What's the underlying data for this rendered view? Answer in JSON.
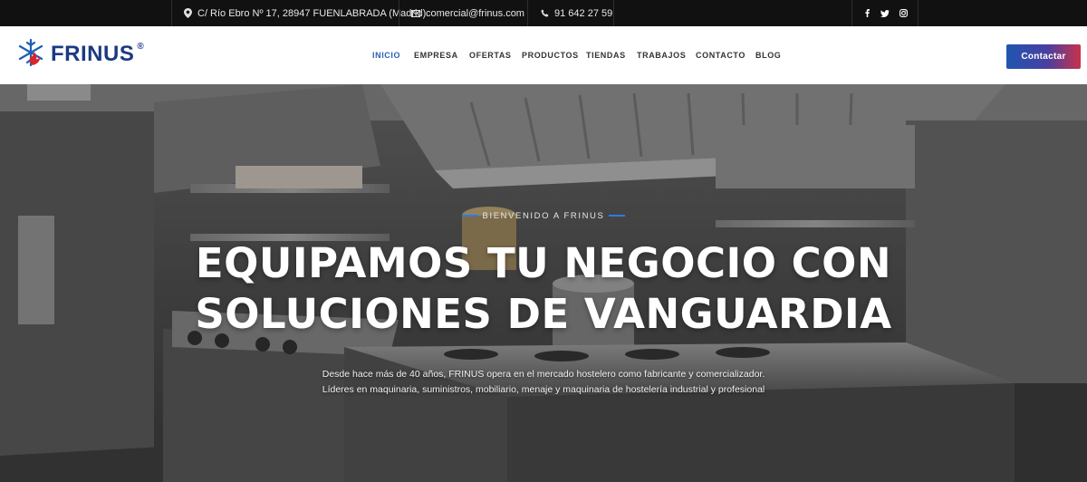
{
  "topbar": {
    "address": "C/ Río Ebro Nº 17, 28947 FUENLABRADA (Madrid)",
    "email": "comercial@frinus.com",
    "phone": "91 642 27 59",
    "icons": {
      "address": "map-marker-icon",
      "email": "envelope-icon",
      "phone": "phone-icon"
    },
    "social": [
      "facebook-icon",
      "twitter-icon",
      "instagram-icon"
    ]
  },
  "header": {
    "logo_text": "FRINUS",
    "logo_reg": "®",
    "nav": [
      {
        "label": "INICIO",
        "active": true
      },
      {
        "label": "EMPRESA",
        "active": false
      },
      {
        "label": "OFERTAS",
        "active": false
      },
      {
        "label": "PRODUCTOS",
        "active": false
      },
      {
        "label": "TIENDAS",
        "active": false
      },
      {
        "label": "TRABAJOS",
        "active": false
      },
      {
        "label": "CONTACTO",
        "active": false
      },
      {
        "label": "BLOG",
        "active": false
      }
    ],
    "cta_label": "Contactar"
  },
  "hero": {
    "eyebrow": "BIENVENIDO A FRINUS",
    "headline_line1": "EQUIPAMOS TU NEGOCIO CON",
    "headline_line2": "SOLUCIONES DE VANGUARDIA",
    "subtitle_line1": "Desde hace más de 40 años, FRINUS opera en el mercado hostelero como fabricante y comercializador.",
    "subtitle_line2": "Líderes en maquinaria, suministros, mobiliario, menaje y maquinaria de hostelería industrial y profesional"
  },
  "colors": {
    "brand_blue": "#1c3a82",
    "nav_active": "#2b63b6",
    "accent_line": "#2f7be0",
    "cta_gradient_start": "#1f56b0",
    "cta_gradient_end": "#c8324a",
    "topbar_bg": "#111111"
  }
}
